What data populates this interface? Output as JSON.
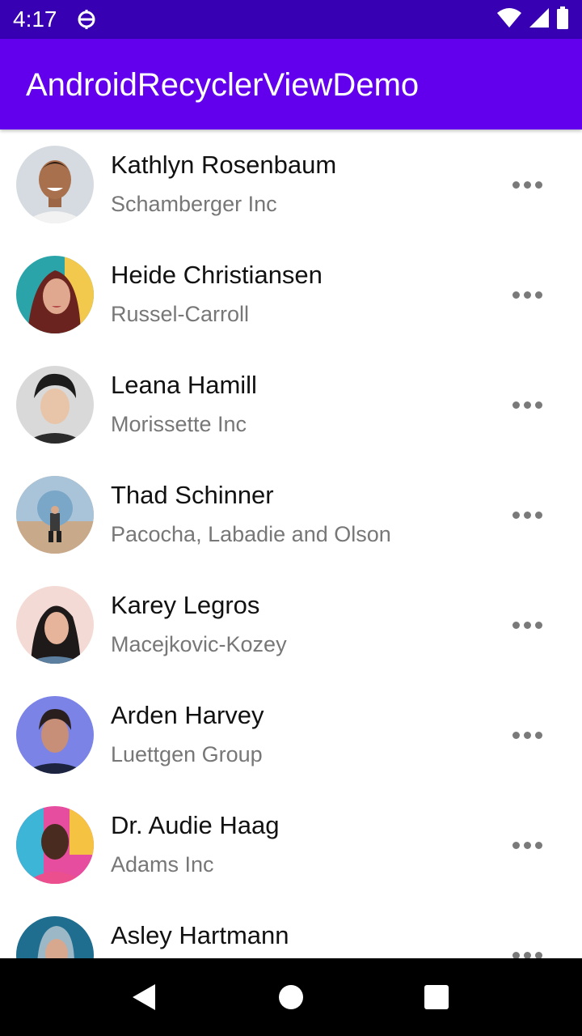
{
  "status_bar": {
    "time": "4:17",
    "icons": [
      "notification-icon",
      "wifi-icon",
      "cell-signal-icon",
      "battery-icon"
    ],
    "color": "#3700b3"
  },
  "app_bar": {
    "title": "AndroidRecyclerViewDemo",
    "color": "#6200ee"
  },
  "contacts": [
    {
      "name": "Kathlyn Rosenbaum",
      "company": "Schamberger Inc"
    },
    {
      "name": "Heide Christiansen",
      "company": "Russel-Carroll"
    },
    {
      "name": "Leana Hamill",
      "company": "Morissette Inc"
    },
    {
      "name": "Thad Schinner",
      "company": "Pacocha, Labadie and Olson"
    },
    {
      "name": "Karey Legros",
      "company": "Macejkovic-Kozey"
    },
    {
      "name": "Arden Harvey",
      "company": "Luettgen Group"
    },
    {
      "name": "Dr. Audie Haag",
      "company": "Adams Inc"
    },
    {
      "name": "Asley Hartmann",
      "company": ""
    }
  ],
  "row_icon": "more-horizontal-icon",
  "nav_bar": {
    "icons": [
      "back-icon",
      "home-icon",
      "recents-icon"
    ]
  }
}
